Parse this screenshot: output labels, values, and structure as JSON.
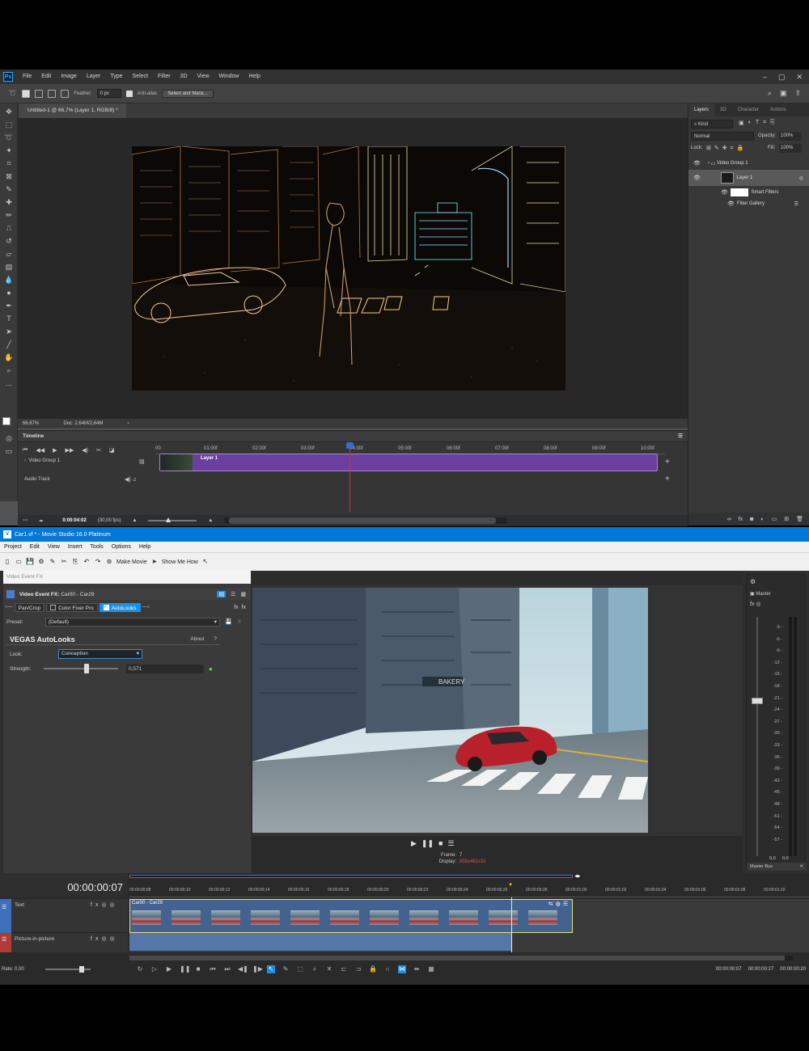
{
  "photoshop": {
    "menu": [
      "File",
      "Edit",
      "Image",
      "Layer",
      "Type",
      "Select",
      "Filter",
      "3D",
      "View",
      "Window",
      "Help"
    ],
    "options": {
      "feather_label": "Feather:",
      "feather_value": "0 px",
      "antialias_label": "Anti-alias",
      "select_mask_button": "Select and Mask..."
    },
    "doc_tab": "Untitled-1 @ 66,7% (Layer 1, RGB/8) *",
    "status": {
      "zoom": "66,67%",
      "doc": "Doc: 2,64M/2,64M"
    },
    "timeline": {
      "title": "Timeline",
      "ruler": [
        "00",
        "01:00f",
        "02:00f",
        "03:00f",
        "04:00f",
        "05:00f",
        "06:00f",
        "07:00f",
        "08:00f",
        "09:00f",
        "10:00f"
      ],
      "track_video": "Video Group 1",
      "clip_label": "Layer 1",
      "track_audio": "Audio Track",
      "timecode": "0:00:04:02",
      "fps": "(30,00 fps)",
      "playhead_fraction": 0.4
    },
    "panels": {
      "tabs": [
        "Layers",
        "3D",
        "Character",
        "Actions"
      ],
      "kind": "Kind",
      "blend": "Normal",
      "opacity_label": "Opacity:",
      "opacity": "100%",
      "lock_label": "Lock:",
      "fill_label": "Fill:",
      "fill": "100%",
      "layers": [
        "Video Group 1",
        "Layer 1",
        "Smart Filters",
        "Filter Gallery"
      ]
    }
  },
  "vegas": {
    "title": "Car1.vf * - Movie Studio 16.0 Platinum",
    "menu": [
      "Project",
      "Edit",
      "View",
      "Insert",
      "Tools",
      "Options",
      "Help"
    ],
    "toolbar": {
      "make_movie": "Make Movie",
      "show_me_how": "Show Me How"
    },
    "fx": {
      "window_title": "Video Event FX",
      "header": "Video Event FX:",
      "clip": "Car00 - Car29",
      "chain": [
        "Pan/Crop",
        "Color Fixer Pro",
        "AutoLooks"
      ],
      "preset_label": "Preset:",
      "preset": "(Default)",
      "plugin": "VEGAS AutoLooks",
      "about": "About",
      "help": "?",
      "look_label": "Look:",
      "look": "Conception",
      "strength_label": "Strength:",
      "strength": "0,571",
      "strength_fraction": 0.571
    },
    "preview": {
      "frame_label": "Frame:",
      "frame": "7",
      "display_label": "Display:",
      "display": "855x481x32"
    },
    "master": {
      "label": "Master",
      "db": [
        "3",
        "6",
        "9",
        "12",
        "15",
        "18",
        "21",
        "24",
        "27",
        "30",
        "33",
        "36",
        "39",
        "42",
        "45",
        "48",
        "51",
        "54",
        "57"
      ],
      "bottom": "0,0",
      "bus": "Master Bus"
    },
    "timeline": {
      "timecode": "00:00:00:07",
      "ruler": [
        "00:00:00;08",
        "00:00:00;10",
        "00:00:00;12",
        "00:00:00;14",
        "00:00:00;16",
        "00:00:00;18",
        "00:00:00;20",
        "00:00:00;22",
        "00:00:00;24",
        "00:00:00;26",
        "00:00:00;28",
        "00:00:01;00",
        "00:00:01;02",
        "00:00:01;04",
        "00:00:01;06",
        "00:00:01;08",
        "00:00:01;10"
      ],
      "track1": "Text",
      "track2": "Picture-in-picture",
      "clip": "Car00 - Car29",
      "rate": "Rate: 0,00",
      "tc1": "00:00:00:07",
      "tc2": "00:00:00:27",
      "tc3": "00:00:00:20"
    }
  }
}
